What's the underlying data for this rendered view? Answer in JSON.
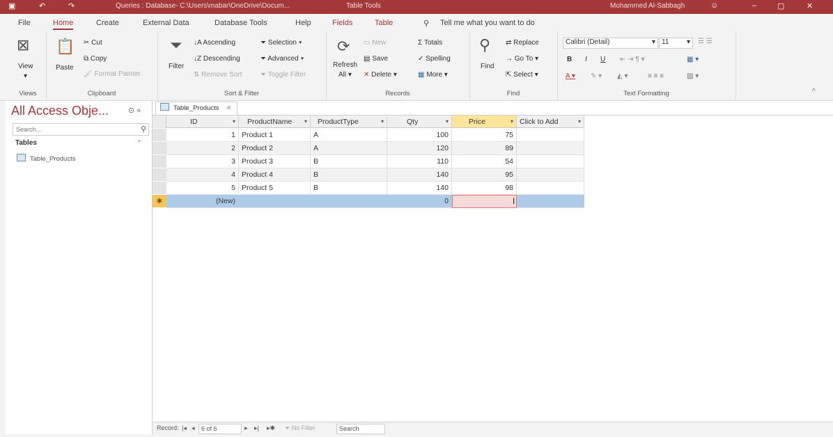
{
  "window": {
    "title": "Queries : Database- C:\\Users\\mabar\\OneDrive\\Docum...",
    "context_tab_group": "Table Tools",
    "user": "Mohammed Al-Sabbagh",
    "minimize_glyph": "–",
    "restore_glyph": "▢",
    "close_glyph": "✕"
  },
  "menu": {
    "items": [
      "File",
      "Home",
      "Create",
      "External Data",
      "Database Tools",
      "Help",
      "Fields",
      "Table"
    ],
    "active": "Home",
    "tell_me": "Tell me what you want to do"
  },
  "ribbon": {
    "views": {
      "view": "View",
      "group": "Views"
    },
    "clipboard": {
      "paste": "Paste",
      "cut": "Cut",
      "copy": "Copy",
      "format_painter": "Format Painter",
      "group": "Clipboard"
    },
    "sort_filter": {
      "filter": "Filter",
      "ascending": "Ascending",
      "descending": "Descending",
      "remove_sort": "Remove Sort",
      "selection": "Selection",
      "advanced": "Advanced",
      "toggle_filter": "Toggle Filter",
      "group": "Sort & Filter"
    },
    "records": {
      "refresh": "Refresh",
      "refresh_all": "All",
      "new": "New",
      "save": "Save",
      "delete": "Delete",
      "totals": "Totals",
      "spelling": "Spelling",
      "more": "More",
      "group": "Records"
    },
    "find": {
      "find": "Find",
      "replace": "Replace",
      "goto": "Go To",
      "select": "Select",
      "group": "Find"
    },
    "text_formatting": {
      "font": "Calibri (Detail)",
      "size": "11",
      "bold": "B",
      "italic": "I",
      "underline": "U",
      "group": "Text Formatting"
    }
  },
  "nav_pane": {
    "title": "All Access Obje...",
    "search_placeholder": "Search...",
    "section": "Tables",
    "objects": [
      "Table_Products"
    ]
  },
  "document_tab": {
    "label": "Table_Products"
  },
  "table": {
    "columns": [
      "ID",
      "ProductName",
      "ProductType",
      "Qty",
      "Price",
      "Click to Add"
    ],
    "selected_column": "Price",
    "rows": [
      [
        "1",
        "Product 1",
        "A",
        "100",
        "75",
        ""
      ],
      [
        "2",
        "Product 2",
        "A",
        "120",
        "89",
        ""
      ],
      [
        "3",
        "Product 3",
        "B",
        "110",
        "54",
        ""
      ],
      [
        "4",
        "Product 4",
        "B",
        "140",
        "95",
        ""
      ],
      [
        "5",
        "Product 5",
        "B",
        "140",
        "98",
        ""
      ]
    ],
    "new_row": [
      "(New)",
      "",
      "",
      "0",
      "",
      ""
    ]
  },
  "record_nav": {
    "label": "Record:",
    "position": "6 of 6",
    "filter_state": "No Filter",
    "search": "Search"
  }
}
